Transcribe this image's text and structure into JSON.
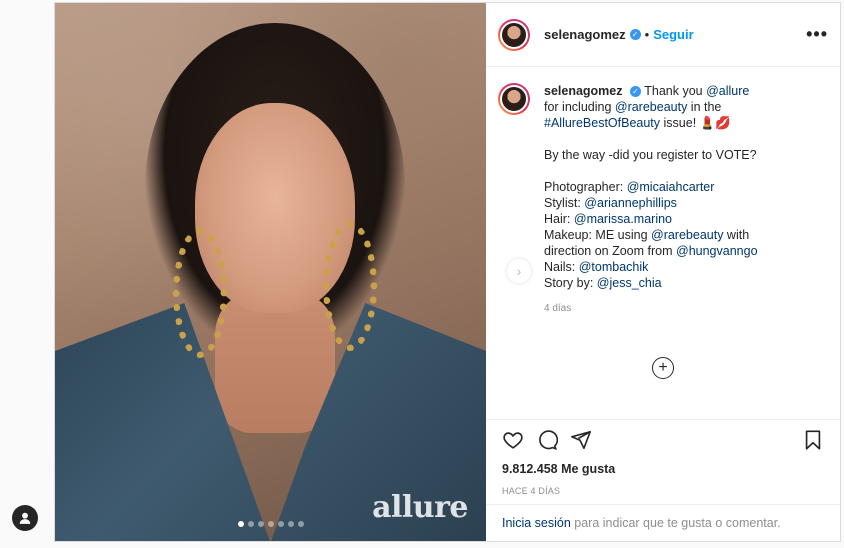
{
  "header": {
    "username": "selenagomez",
    "follow_label": "Seguir",
    "separator": "•",
    "more_icon": "more-horizontal-icon"
  },
  "caption": {
    "username": "selenagomez",
    "line1_text": "Thank you ",
    "line1_mention": "@allure",
    "line2_text": "for including ",
    "line2_mention": "@rarebeauty",
    "line2_suffix": " in the",
    "hashtag": "#AllureBestOfBeauty",
    "hashtag_suffix": " issue! 💄💋",
    "vote": "By the way -did you register to VOTE?",
    "photographer_label": "Photographer: ",
    "photographer": "@micaiahcarter",
    "stylist_label": "Stylist: ",
    "stylist": "@ariannephillips",
    "hair_label": "Hair: ",
    "hair": "@marissa.marino",
    "makeup_label": "Makeup: ME using ",
    "makeup": "@rarebeauty",
    "makeup_suffix": " with direction on Zoom from",
    "makeup2": "@hungvanngo",
    "nails_label": "Nails: ",
    "nails": "@tombachik",
    "story_label": "Story by: ",
    "story": "@jess_chia",
    "time": "4 días"
  },
  "media": {
    "watermark": "allure",
    "slide_count": 7,
    "active_slide": 0
  },
  "actions": {
    "likes": "9.812.458 Me gusta",
    "posted_ago": "HACE 4 DÍAS"
  },
  "login": {
    "link": "Inicia sesión",
    "text": " para indicar que te gusta o comentar."
  },
  "colors": {
    "link": "#00376b",
    "follow": "#0095f6",
    "verified": "#3897f0"
  }
}
